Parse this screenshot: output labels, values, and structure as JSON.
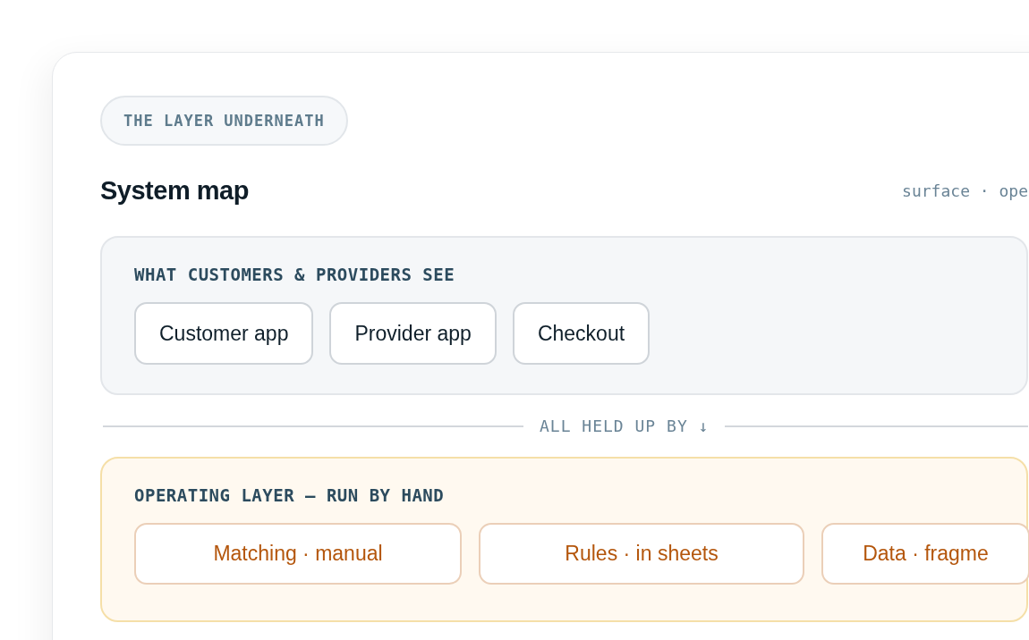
{
  "eyebrow": "THE LAYER UNDERNEATH",
  "title": "System map",
  "legend": "surface · ope",
  "layers": [
    {
      "kind": "surface",
      "heading": "WHAT CUSTOMERS & PROVIDERS SEE",
      "items": [
        "Customer app",
        "Provider app",
        "Checkout"
      ]
    },
    {
      "kind": "operating",
      "heading": "OPERATING LAYER — RUN BY HAND",
      "items": [
        "Matching · manual",
        "Rules · in sheets",
        "Data · fragme"
      ]
    }
  ],
  "divider": "ALL HELD UP BY ↓"
}
